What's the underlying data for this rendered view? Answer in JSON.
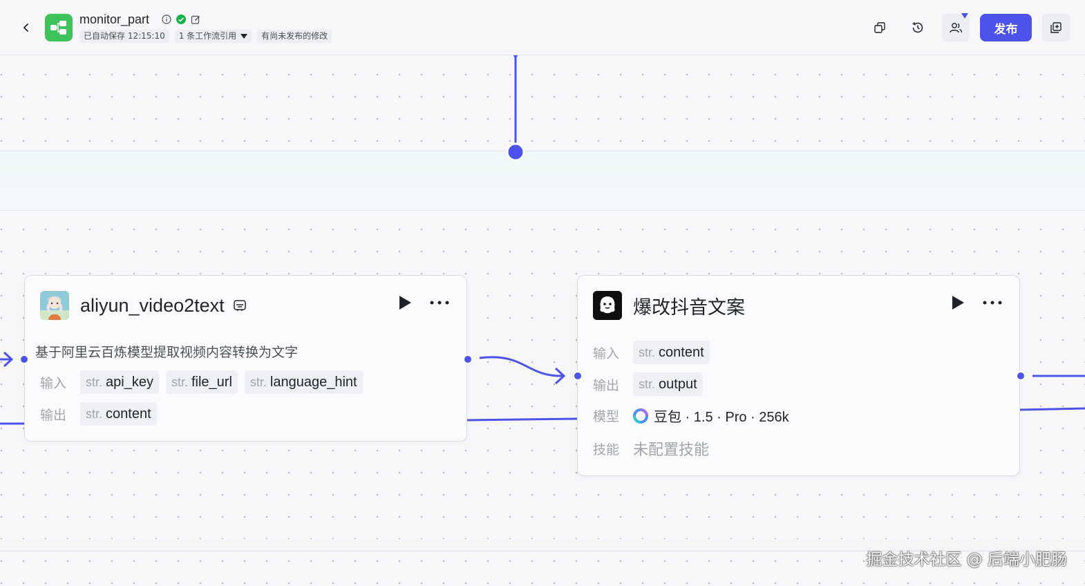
{
  "header": {
    "title": "monitor_part",
    "autosave": "已自动保存 12:15:10",
    "references": "1 条工作流引用",
    "unpublished": "有尚未发布的修改",
    "publish_label": "发布"
  },
  "nodes": {
    "video2text": {
      "title": "aliyun_video2text",
      "description": "基于阿里云百炼模型提取视频内容转换为文字",
      "input_label": "输入",
      "output_label": "输出",
      "inputs": [
        {
          "type": "str.",
          "name": "api_key"
        },
        {
          "type": "str.",
          "name": "file_url"
        },
        {
          "type": "str.",
          "name": "language_hint"
        }
      ],
      "outputs": [
        {
          "type": "str.",
          "name": "content"
        }
      ]
    },
    "rewrite": {
      "title": "爆改抖音文案",
      "input_label": "输入",
      "output_label": "输出",
      "model_label": "模型",
      "skill_label": "技能",
      "inputs": [
        {
          "type": "str.",
          "name": "content"
        }
      ],
      "outputs": [
        {
          "type": "str.",
          "name": "output"
        }
      ],
      "model": "豆包 · 1.5 · Pro · 256k",
      "skill": "未配置技能"
    }
  },
  "watermark": "掘金技术社区 @ 后端小肥肠",
  "colors": {
    "accent": "#4d53e8",
    "app_icon": "#3ec25c",
    "status_ok": "#18b24a"
  },
  "icons": {
    "back": "chevron-left-icon",
    "app": "workflow-icon",
    "info": "info-icon",
    "status": "check-circle-icon",
    "edit": "edit-icon",
    "copy": "copy-icon",
    "history": "history-icon",
    "collab": "users-icon",
    "more": "more-icon",
    "run": "play-icon"
  }
}
